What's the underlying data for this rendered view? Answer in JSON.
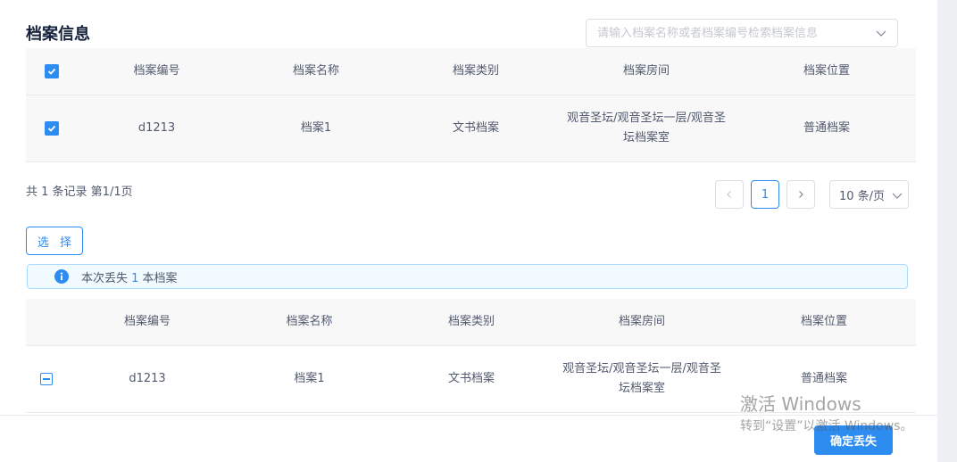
{
  "title": "档案信息",
  "search": {
    "placeholder": "请输入档案名称或者档案编号检索档案信息",
    "icon": "chevron-down-icon"
  },
  "columns": [
    "档案编号",
    "档案名称",
    "档案类别",
    "档案房间",
    "档案位置"
  ],
  "top_table": {
    "header_checked": true,
    "rows": [
      {
        "checked": true,
        "code": "d1213",
        "name": "档案1",
        "category": "文书档案",
        "room": "观音圣坛/观音圣坛一层/观音圣坛档案室",
        "location": "普通档案"
      }
    ]
  },
  "pagination": {
    "total_text": "共 1 条记录 第1/1页",
    "prev": "<",
    "current": "1",
    "next": ">",
    "page_size": "10 条/页"
  },
  "select_button": "选 择",
  "alert": {
    "prefix": "本次丢失 ",
    "count": "1",
    "suffix": " 本档案",
    "icon": "info-icon"
  },
  "bottom_table": {
    "rows": [
      {
        "code": "d1213",
        "name": "档案1",
        "category": "文书档案",
        "room": "观音圣坛/观音圣坛一层/观音圣坛档案室",
        "location": "普通档案"
      }
    ]
  },
  "confirm_button": "确定丢失",
  "watermark": {
    "line1": "激活 Windows",
    "line2": "转到“设置”以激活 Windows。"
  },
  "colors": {
    "primary": "#2d8cf0",
    "header_bg": "#f8f8f9",
    "alert_bg": "#f0faff",
    "alert_border": "#abdcff"
  }
}
